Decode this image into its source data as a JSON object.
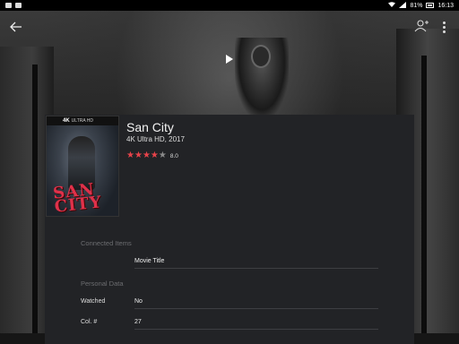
{
  "status_bar": {
    "battery": "81%",
    "time": "16:13"
  },
  "movie": {
    "title": "San City",
    "subtitle": "4K Ultra HD, 2017",
    "rating": 8.0,
    "rating_text": "8.0",
    "stars_filled": 4,
    "stars_total": 5,
    "poster": {
      "badge_strong": "4K",
      "badge_text": "ULTRA HD",
      "title_line1": "SAN",
      "title_line2": "CITY"
    }
  },
  "sections": {
    "connected": {
      "heading": "Connected Items",
      "items": [
        {
          "value": "Movie Title"
        }
      ]
    },
    "personal": {
      "heading": "Personal Data",
      "rows": [
        {
          "label": "Watched",
          "value": "No"
        },
        {
          "label": "Col. #",
          "value": "27"
        }
      ]
    }
  },
  "colors": {
    "star_filled": "#e8434a",
    "star_empty": "#8a8a8a",
    "panel": "#222326"
  }
}
